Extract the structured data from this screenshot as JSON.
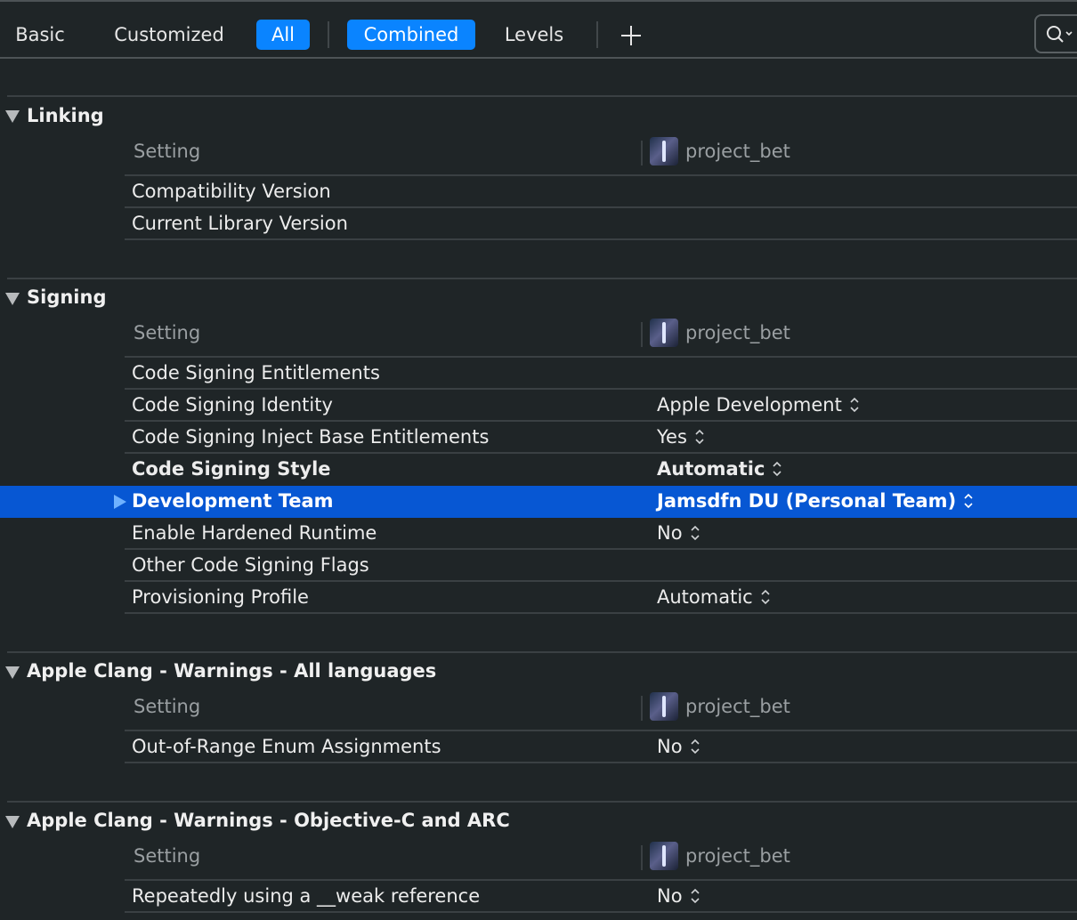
{
  "toolbar": {
    "tabs": [
      {
        "label": "Basic",
        "active": false
      },
      {
        "label": "Customized",
        "active": false
      },
      {
        "label": "All",
        "active": true
      },
      {
        "label": "Combined",
        "active": true
      },
      {
        "label": "Levels",
        "active": false
      }
    ],
    "add_icon": "plus-icon",
    "search_icon": "search-icon"
  },
  "colors": {
    "background": "#1f2527",
    "accent": "#0a84ff",
    "selection": "#0757d3"
  },
  "sections": [
    {
      "title": "Linking",
      "column_setting": "Setting",
      "column_target": "project_bet",
      "rows": [
        {
          "label": "Compatibility Version",
          "value": ""
        },
        {
          "label": "Current Library Version",
          "value": ""
        }
      ]
    },
    {
      "title": "Signing",
      "column_setting": "Setting",
      "column_target": "project_bet",
      "rows": [
        {
          "label": "Code Signing Entitlements",
          "value": ""
        },
        {
          "label": "Code Signing Identity",
          "value": "Apple Development"
        },
        {
          "label": "Code Signing Inject Base Entitlements",
          "value": "Yes"
        },
        {
          "label": "Code Signing Style",
          "value": "Automatic"
        },
        {
          "label": "Development Team",
          "value": "Jamsdfn DU (Personal Team)"
        },
        {
          "label": "Enable Hardened Runtime",
          "value": "No"
        },
        {
          "label": "Other Code Signing Flags",
          "value": ""
        },
        {
          "label": "Provisioning Profile",
          "value": "Automatic"
        }
      ]
    },
    {
      "title": "Apple Clang - Warnings - All languages",
      "column_setting": "Setting",
      "column_target": "project_bet",
      "rows": [
        {
          "label": "Out-of-Range Enum Assignments",
          "value": "No"
        }
      ]
    },
    {
      "title": "Apple Clang - Warnings - Objective-C and ARC",
      "column_setting": "Setting",
      "column_target": "project_bet",
      "rows": [
        {
          "label": "Repeatedly using a __weak reference",
          "value": "No"
        }
      ]
    }
  ]
}
